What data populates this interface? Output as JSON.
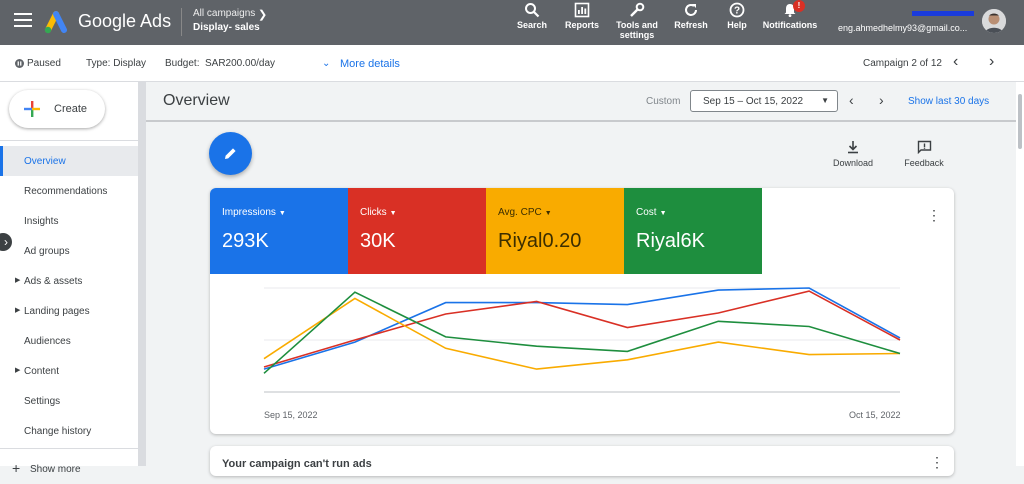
{
  "header": {
    "brand": "Google Ads",
    "campaign_scope": "All campaigns",
    "campaign_name": "Display- sales",
    "tools": [
      {
        "label": "Search",
        "icon": "search-icon"
      },
      {
        "label": "Reports",
        "icon": "reports-icon"
      },
      {
        "label": "Tools and settings",
        "icon": "wrench-icon"
      },
      {
        "label": "Refresh",
        "icon": "refresh-icon"
      },
      {
        "label": "Help",
        "icon": "help-icon"
      },
      {
        "label": "Notifications",
        "icon": "bell-icon",
        "badge": "!"
      }
    ],
    "account_email": "eng.ahmedhelmy93@gmail.co..."
  },
  "subheader": {
    "status": "Paused",
    "type": "Type: Display",
    "budget_label": "Budget:",
    "budget_value": "SAR200.00/day",
    "more_details": "More details",
    "campaign_counter": "Campaign 2 of 12"
  },
  "sidebar": {
    "create_label": "Create",
    "items": [
      {
        "label": "Overview",
        "active": true,
        "expandable": false
      },
      {
        "label": "Recommendations",
        "active": false,
        "expandable": false
      },
      {
        "label": "Insights",
        "active": false,
        "expandable": false
      },
      {
        "label": "Ad groups",
        "active": false,
        "expandable": false
      },
      {
        "label": "Ads & assets",
        "active": false,
        "expandable": true
      },
      {
        "label": "Landing pages",
        "active": false,
        "expandable": true
      },
      {
        "label": "Audiences",
        "active": false,
        "expandable": false
      },
      {
        "label": "Content",
        "active": false,
        "expandable": true
      },
      {
        "label": "Settings",
        "active": false,
        "expandable": false
      },
      {
        "label": "Change history",
        "active": false,
        "expandable": false
      },
      {
        "label": "Show more",
        "active": false,
        "expandable": false
      }
    ]
  },
  "main": {
    "title": "Overview",
    "custom_label": "Custom",
    "date_range": "Sep 15 – Oct 15, 2022",
    "show_last": "Show last 30 days",
    "actions": [
      {
        "label": "Download",
        "icon": "download-icon"
      },
      {
        "label": "Feedback",
        "icon": "feedback-icon"
      }
    ],
    "metrics": [
      {
        "label": "Impressions",
        "value": "293K",
        "color": "#1a73e8"
      },
      {
        "label": "Clicks",
        "value": "30K",
        "color": "#d93025"
      },
      {
        "label": "Avg. CPC",
        "value": "Riyal0.20",
        "color": "#f9ab00"
      },
      {
        "label": "Cost",
        "value": "Riyal6K",
        "color": "#1e8e3e"
      }
    ],
    "second_card_title": "Your campaign can't run ads"
  },
  "chart_data": {
    "type": "line",
    "x": [
      "Sep 15, 2022",
      "",
      "",
      "",
      "",
      "",
      "",
      "",
      "",
      "Oct 15, 2022"
    ],
    "x_tick_labels": [
      "Sep 15, 2022",
      "Oct 15, 2022"
    ],
    "series": [
      {
        "name": "Impressions",
        "color": "#1a73e8",
        "values": [
          0.22,
          0.48,
          0.86,
          0.86,
          0.84,
          0.98,
          1.0,
          0.52
        ]
      },
      {
        "name": "Clicks",
        "color": "#d93025",
        "values": [
          0.24,
          0.5,
          0.75,
          0.87,
          0.62,
          0.76,
          0.97,
          0.5
        ]
      },
      {
        "name": "Avg. CPC",
        "color": "#f9ab00",
        "values": [
          0.32,
          0.9,
          0.42,
          0.22,
          0.31,
          0.48,
          0.36,
          0.37
        ]
      },
      {
        "name": "Cost",
        "color": "#1e8e3e",
        "values": [
          0.18,
          0.96,
          0.53,
          0.44,
          0.39,
          0.68,
          0.63,
          0.37
        ]
      }
    ],
    "grid": true
  }
}
